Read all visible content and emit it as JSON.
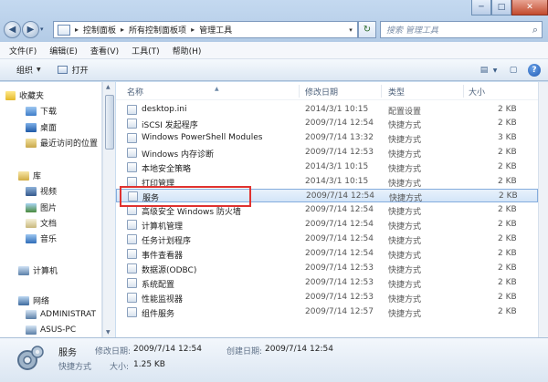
{
  "window": {
    "controls": {
      "minimize": "─",
      "maximize": "□",
      "close": "✕"
    }
  },
  "addressbar": {
    "back": "◀",
    "forward": "▶",
    "dropdown": "▾",
    "crumbs": [
      "控制面板",
      "所有控制面板项",
      "管理工具"
    ],
    "refresh": "↻",
    "search_placeholder": "搜索 管理工具"
  },
  "menubar": {
    "items": [
      "文件(F)",
      "编辑(E)",
      "查看(V)",
      "工具(T)",
      "帮助(H)"
    ]
  },
  "toolbar": {
    "organize_label": "组织",
    "open_label": "打开"
  },
  "navpane": {
    "favorites": "收藏夹",
    "favorites_items": [
      "下载",
      "桌面",
      "最近访问的位置"
    ],
    "libraries": "库",
    "library_items": [
      "视频",
      "图片",
      "文档",
      "音乐"
    ],
    "computer": "计算机",
    "network": "网络",
    "network_items": [
      "ADMINISTRAT",
      "ASUS-PC"
    ]
  },
  "columns": {
    "name": "名称",
    "date": "修改日期",
    "type": "类型",
    "size": "大小"
  },
  "files": [
    {
      "name": "desktop.ini",
      "date": "2014/3/1 10:15",
      "type": "配置设置",
      "size": "2 KB"
    },
    {
      "name": "iSCSI 发起程序",
      "date": "2009/7/14 12:54",
      "type": "快捷方式",
      "size": "2 KB"
    },
    {
      "name": "Windows PowerShell Modules",
      "date": "2009/7/14 13:32",
      "type": "快捷方式",
      "size": "3 KB"
    },
    {
      "name": "Windows 内存诊断",
      "date": "2009/7/14 12:53",
      "type": "快捷方式",
      "size": "2 KB"
    },
    {
      "name": "本地安全策略",
      "date": "2014/3/1 10:15",
      "type": "快捷方式",
      "size": "2 KB"
    },
    {
      "name": "打印管理",
      "date": "2014/3/1 10:15",
      "type": "快捷方式",
      "size": "2 KB"
    },
    {
      "name": "服务",
      "date": "2009/7/14 12:54",
      "type": "快捷方式",
      "size": "2 KB"
    },
    {
      "name": "高级安全 Windows 防火墙",
      "date": "2009/7/14 12:54",
      "type": "快捷方式",
      "size": "2 KB"
    },
    {
      "name": "计算机管理",
      "date": "2009/7/14 12:54",
      "type": "快捷方式",
      "size": "2 KB"
    },
    {
      "name": "任务计划程序",
      "date": "2009/7/14 12:54",
      "type": "快捷方式",
      "size": "2 KB"
    },
    {
      "name": "事件查看器",
      "date": "2009/7/14 12:54",
      "type": "快捷方式",
      "size": "2 KB"
    },
    {
      "name": "数据源(ODBC)",
      "date": "2009/7/14 12:53",
      "type": "快捷方式",
      "size": "2 KB"
    },
    {
      "name": "系统配置",
      "date": "2009/7/14 12:53",
      "type": "快捷方式",
      "size": "2 KB"
    },
    {
      "name": "性能监视器",
      "date": "2009/7/14 12:53",
      "type": "快捷方式",
      "size": "2 KB"
    },
    {
      "name": "组件服务",
      "date": "2009/7/14 12:57",
      "type": "快捷方式",
      "size": "2 KB"
    }
  ],
  "details": {
    "name": "服务",
    "type": "快捷方式",
    "modified_label": "修改日期:",
    "modified": "2009/7/14 12:54",
    "created_label": "创建日期:",
    "created": "2009/7/14 12:54",
    "size_label": "大小:",
    "size": "1.25 KB"
  },
  "colors": {
    "selection": "#d3e5f8",
    "highlight_box": "#e0322f"
  }
}
